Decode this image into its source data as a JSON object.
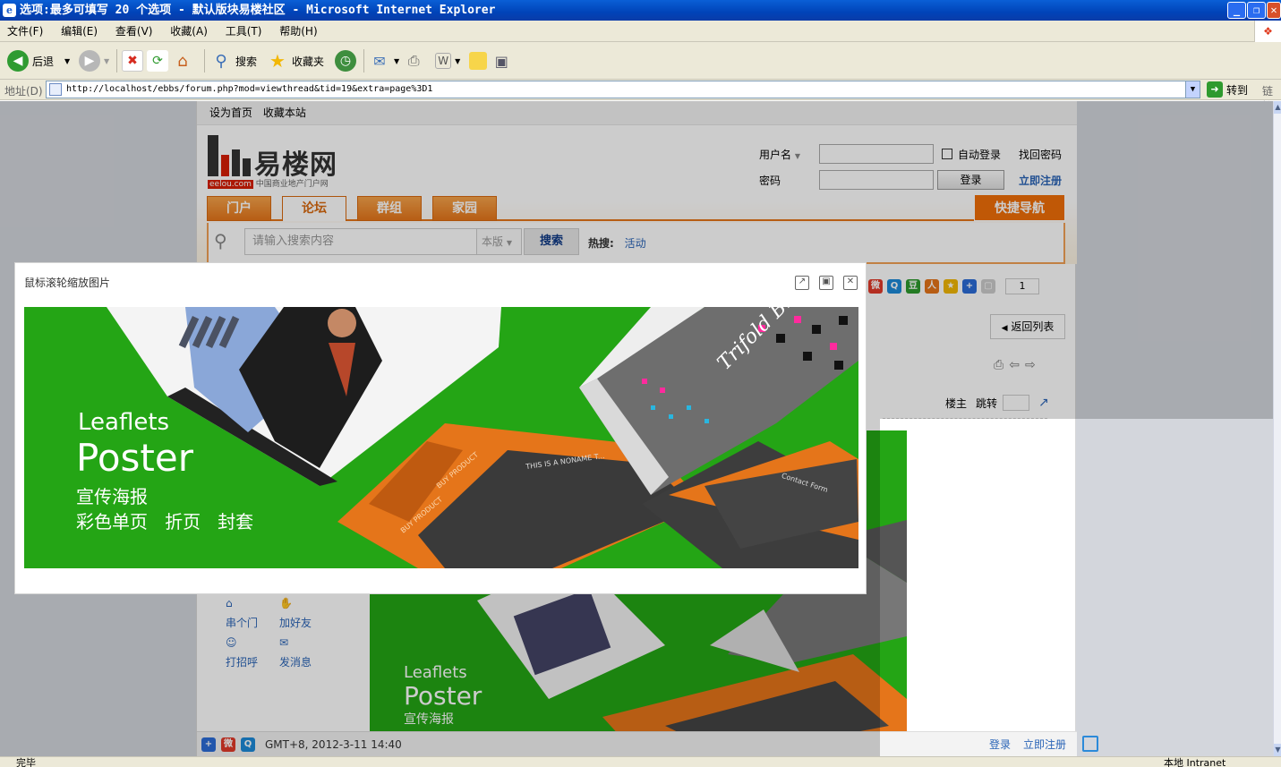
{
  "window": {
    "title": "选项:最多可填写 20 个选项 - 默认版块易楼社区 - Microsoft Internet Explorer",
    "min": "_",
    "max": "❐",
    "close": "✕"
  },
  "menu": [
    "文件(F)",
    "编辑(E)",
    "查看(V)",
    "收藏(A)",
    "工具(T)",
    "帮助(H)"
  ],
  "toolbar": {
    "back": "后退",
    "search": "搜索",
    "favorites": "收藏夹"
  },
  "address": {
    "label": "地址(D)",
    "url": "http://localhost/ebbs/forum.php?mod=viewthread&tid=19&extra=page%3D1",
    "go": "转到",
    "links": "链接"
  },
  "status": {
    "text": "完毕",
    "zone": "本地 Intranet"
  },
  "site": {
    "top_links": [
      "设为首页",
      "收藏本站"
    ],
    "logo_text": "易楼网",
    "logo_domain": "eelou.com",
    "logo_tagline": "中国商业地产门户网",
    "login": {
      "username_label": "用户名",
      "password_label": "密码",
      "auto_login": "自动登录",
      "forgot": "找回密码",
      "login_btn": "登录",
      "register": "立即注册"
    },
    "nav_tabs": [
      "门户",
      "论坛",
      "群组",
      "家园"
    ],
    "quick_nav": "快捷导航",
    "search": {
      "placeholder": "请输入搜索内容",
      "scope": "本版",
      "button": "搜索",
      "hot_label": "热搜:",
      "hot_item": "活动"
    },
    "page_num": "1",
    "back_to_list": "返回列表",
    "louzhu": "楼主",
    "jump": "跳转",
    "profile_links": [
      "串个门",
      "加好友",
      "打招呼",
      "发消息"
    ],
    "footer_time": "GMT+8, 2012-3-11 14:40",
    "footer_login": "登录",
    "footer_register": "立即注册"
  },
  "modal": {
    "title": "鼠标滚轮缩放图片",
    "poster": {
      "line1": "Leaflets",
      "line2": "Poster",
      "line3": "宣传海报",
      "line4": "彩色单页   折页   封套",
      "brochure": "Trifold Brochure",
      "product_a": "BUY PRODUCT",
      "product_b": "BUY PRODUCT",
      "contact": "Contact Form",
      "banner": "THIS IS A NONAME T..."
    }
  },
  "colors": {
    "ie_blue": "#0043b8",
    "orange": "#e5751a",
    "poster_green": "#24a515",
    "link_blue": "#2b65b7"
  }
}
